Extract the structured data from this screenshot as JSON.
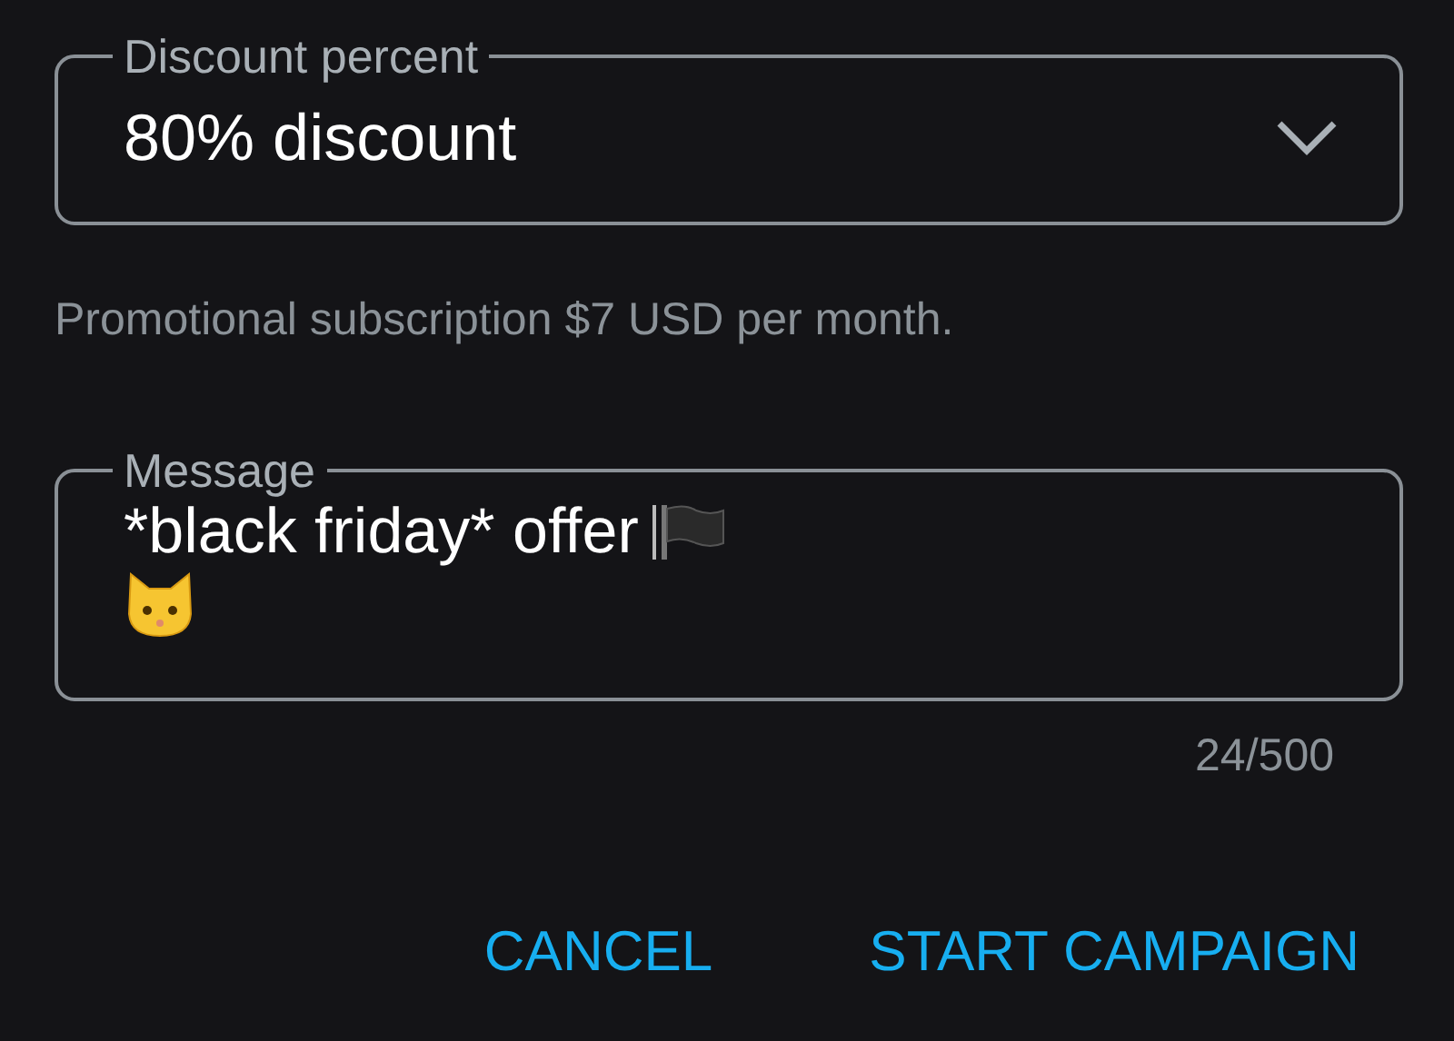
{
  "discount_field": {
    "label": "Discount percent",
    "value": "80% discount"
  },
  "helper_text": "Promotional subscription $7 USD per month.",
  "message_field": {
    "label": "Message",
    "text": "*black friday* offer",
    "counter": "24/500"
  },
  "buttons": [
    {
      "label": "CANCEL"
    },
    {
      "label": "START CAMPAIGN"
    }
  ]
}
